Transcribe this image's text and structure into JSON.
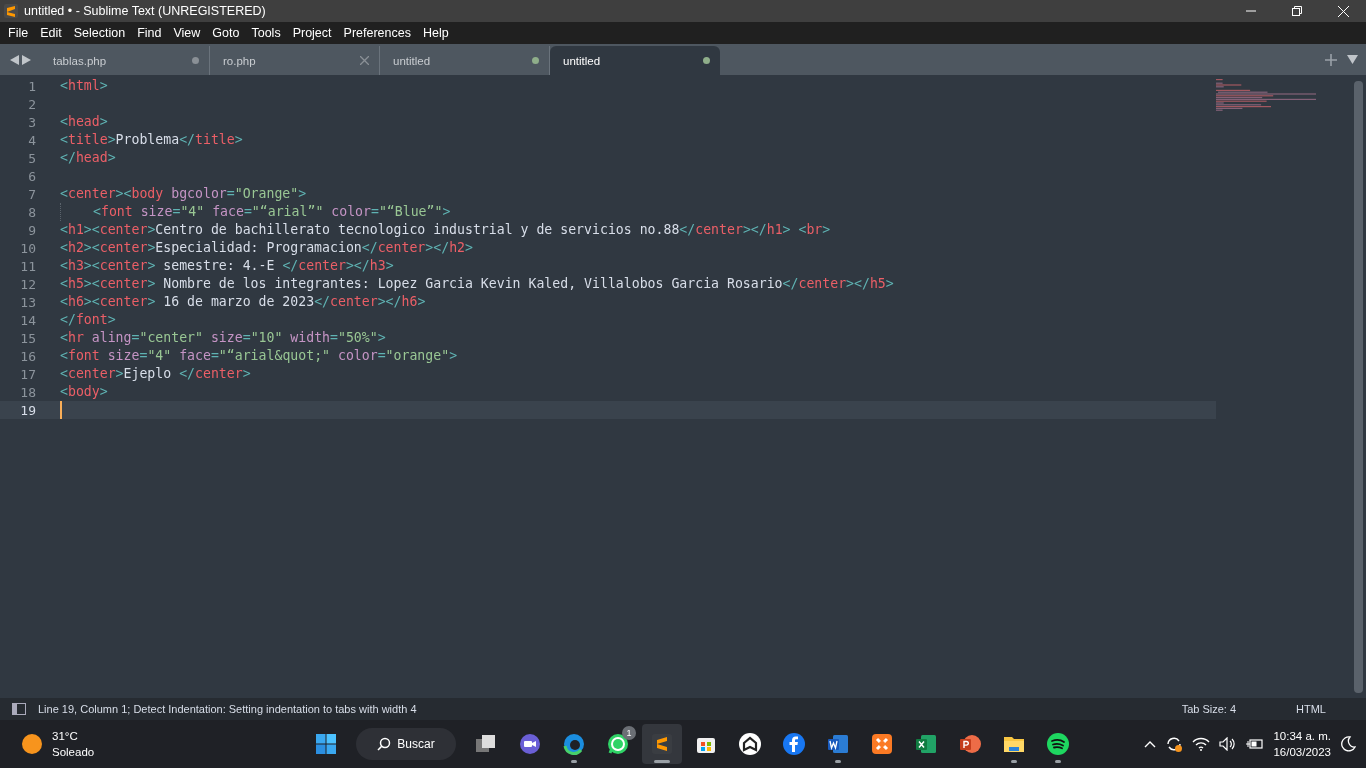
{
  "window": {
    "title": "untitled • - Sublime Text (UNREGISTERED)"
  },
  "menu": [
    "File",
    "Edit",
    "Selection",
    "Find",
    "View",
    "Goto",
    "Tools",
    "Project",
    "Preferences",
    "Help"
  ],
  "tabs": [
    {
      "label": "tablas.php",
      "selected": false,
      "modified": true,
      "color": "#8a9096"
    },
    {
      "label": "ro.php",
      "selected": false,
      "modified": false
    },
    {
      "label": "untitled",
      "selected": false,
      "modified": true,
      "color": "#8fae8a"
    },
    {
      "label": "untitled",
      "selected": true,
      "modified": true,
      "color": "#8fae8a"
    }
  ],
  "editor": {
    "lines": [
      {
        "number": "1",
        "current": false,
        "tokens": [
          {
            "kind": "punct",
            "text": "<"
          },
          {
            "kind": "tag",
            "text": "html"
          },
          {
            "kind": "punct",
            "text": ">"
          }
        ]
      },
      {
        "number": "2",
        "current": false
      },
      {
        "number": "3",
        "current": false,
        "tokens": [
          {
            "kind": "punct",
            "text": "<"
          },
          {
            "kind": "tag",
            "text": "head"
          },
          {
            "kind": "punct",
            "text": ">"
          }
        ]
      },
      {
        "number": "4",
        "current": false,
        "tokens": [
          {
            "kind": "punct",
            "text": "<"
          },
          {
            "kind": "tag",
            "text": "title"
          },
          {
            "kind": "punct",
            "text": ">"
          },
          {
            "kind": "text",
            "text": "Problema"
          },
          {
            "kind": "punct",
            "text": "</"
          },
          {
            "kind": "tag",
            "text": "title"
          },
          {
            "kind": "punct",
            "text": ">"
          }
        ]
      },
      {
        "number": "5",
        "current": false,
        "tokens": [
          {
            "kind": "punct",
            "text": "</"
          },
          {
            "kind": "tag",
            "text": "head"
          },
          {
            "kind": "punct",
            "text": ">"
          }
        ]
      },
      {
        "number": "6",
        "current": false
      },
      {
        "number": "7",
        "current": false,
        "tokens": [
          {
            "kind": "punct",
            "text": "<"
          },
          {
            "kind": "tag",
            "text": "center"
          },
          {
            "kind": "punct",
            "text": "><"
          },
          {
            "kind": "tag",
            "text": "body"
          },
          {
            "kind": "attr",
            "text": " bgcolor"
          },
          {
            "kind": "punct",
            "text": "="
          },
          {
            "kind": "string",
            "text": "\"Orange\""
          },
          {
            "kind": "punct",
            "text": ">"
          }
        ]
      },
      {
        "number": "8",
        "current": false,
        "indented": true,
        "tokens": [
          {
            "kind": "punct",
            "text": "<"
          },
          {
            "kind": "tag",
            "text": "font"
          },
          {
            "kind": "attr",
            "text": " size"
          },
          {
            "kind": "punct",
            "text": "="
          },
          {
            "kind": "string",
            "text": "\"4\""
          },
          {
            "kind": "attr",
            "text": " face"
          },
          {
            "kind": "punct",
            "text": "="
          },
          {
            "kind": "string",
            "text": "\"“arial”\""
          },
          {
            "kind": "attr",
            "text": " color"
          },
          {
            "kind": "punct",
            "text": "="
          },
          {
            "kind": "string",
            "text": "\"“Blue”\""
          },
          {
            "kind": "punct",
            "text": ">"
          }
        ]
      },
      {
        "number": "9",
        "current": false,
        "tokens": [
          {
            "kind": "punct",
            "text": "<"
          },
          {
            "kind": "tag",
            "text": "h1"
          },
          {
            "kind": "punct",
            "text": "><"
          },
          {
            "kind": "tag",
            "text": "center"
          },
          {
            "kind": "punct",
            "text": ">"
          },
          {
            "kind": "text",
            "text": "Centro de bachillerato tecnologico industrial y de servicios no.88"
          },
          {
            "kind": "punct",
            "text": "</"
          },
          {
            "kind": "tag",
            "text": "center"
          },
          {
            "kind": "punct",
            "text": "></"
          },
          {
            "kind": "tag",
            "text": "h1"
          },
          {
            "kind": "punct",
            "text": "> <"
          },
          {
            "kind": "tag",
            "text": "br"
          },
          {
            "kind": "punct",
            "text": ">"
          }
        ]
      },
      {
        "number": "10",
        "current": false,
        "tokens": [
          {
            "kind": "punct",
            "text": "<"
          },
          {
            "kind": "tag",
            "text": "h2"
          },
          {
            "kind": "punct",
            "text": "><"
          },
          {
            "kind": "tag",
            "text": "center"
          },
          {
            "kind": "punct",
            "text": ">"
          },
          {
            "kind": "text",
            "text": "Especialidad: Programacion"
          },
          {
            "kind": "punct",
            "text": "</"
          },
          {
            "kind": "tag",
            "text": "center"
          },
          {
            "kind": "punct",
            "text": "></"
          },
          {
            "kind": "tag",
            "text": "h2"
          },
          {
            "kind": "punct",
            "text": ">"
          }
        ]
      },
      {
        "number": "11",
        "current": false,
        "tokens": [
          {
            "kind": "punct",
            "text": "<"
          },
          {
            "kind": "tag",
            "text": "h3"
          },
          {
            "kind": "punct",
            "text": "><"
          },
          {
            "kind": "tag",
            "text": "center"
          },
          {
            "kind": "punct",
            "text": ">"
          },
          {
            "kind": "text",
            "text": " semestre: 4.-E "
          },
          {
            "kind": "punct",
            "text": "</"
          },
          {
            "kind": "tag",
            "text": "center"
          },
          {
            "kind": "punct",
            "text": "></"
          },
          {
            "kind": "tag",
            "text": "h3"
          },
          {
            "kind": "punct",
            "text": ">"
          }
        ]
      },
      {
        "number": "12",
        "current": false,
        "tokens": [
          {
            "kind": "punct",
            "text": "<"
          },
          {
            "kind": "tag",
            "text": "h5"
          },
          {
            "kind": "punct",
            "text": "><"
          },
          {
            "kind": "tag",
            "text": "center"
          },
          {
            "kind": "punct",
            "text": ">"
          },
          {
            "kind": "text",
            "text": " Nombre de los integrantes: Lopez Garcia Kevin Kaled, Villalobos Garcia Rosario"
          },
          {
            "kind": "punct",
            "text": "</"
          },
          {
            "kind": "tag",
            "text": "center"
          },
          {
            "kind": "punct",
            "text": "></"
          },
          {
            "kind": "tag",
            "text": "h5"
          },
          {
            "kind": "punct",
            "text": ">"
          }
        ]
      },
      {
        "number": "13",
        "current": false,
        "tokens": [
          {
            "kind": "punct",
            "text": "<"
          },
          {
            "kind": "tag",
            "text": "h6"
          },
          {
            "kind": "punct",
            "text": "><"
          },
          {
            "kind": "tag",
            "text": "center"
          },
          {
            "kind": "punct",
            "text": ">"
          },
          {
            "kind": "text",
            "text": " 16 de marzo de 2023"
          },
          {
            "kind": "punct",
            "text": "</"
          },
          {
            "kind": "tag",
            "text": "center"
          },
          {
            "kind": "punct",
            "text": "></"
          },
          {
            "kind": "tag",
            "text": "h6"
          },
          {
            "kind": "punct",
            "text": ">"
          }
        ]
      },
      {
        "number": "14",
        "current": false,
        "tokens": [
          {
            "kind": "punct",
            "text": "</"
          },
          {
            "kind": "tag",
            "text": "font"
          },
          {
            "kind": "punct",
            "text": ">"
          }
        ]
      },
      {
        "number": "15",
        "current": false,
        "tokens": [
          {
            "kind": "punct",
            "text": "<"
          },
          {
            "kind": "tag",
            "text": "hr"
          },
          {
            "kind": "attr",
            "text": " aling"
          },
          {
            "kind": "punct",
            "text": "="
          },
          {
            "kind": "string",
            "text": "\"center\""
          },
          {
            "kind": "attr",
            "text": " size"
          },
          {
            "kind": "punct",
            "text": "="
          },
          {
            "kind": "string",
            "text": "\"10\""
          },
          {
            "kind": "attr",
            "text": " width"
          },
          {
            "kind": "punct",
            "text": "="
          },
          {
            "kind": "string",
            "text": "\"50%\""
          },
          {
            "kind": "punct",
            "text": ">"
          }
        ]
      },
      {
        "number": "16",
        "current": false,
        "tokens": [
          {
            "kind": "punct",
            "text": "<"
          },
          {
            "kind": "tag",
            "text": "font"
          },
          {
            "kind": "attr",
            "text": " size"
          },
          {
            "kind": "punct",
            "text": "="
          },
          {
            "kind": "string",
            "text": "\"4\""
          },
          {
            "kind": "attr",
            "text": " face"
          },
          {
            "kind": "punct",
            "text": "="
          },
          {
            "kind": "string",
            "text": "\"“arial&quot;\""
          },
          {
            "kind": "attr",
            "text": " color"
          },
          {
            "kind": "punct",
            "text": "="
          },
          {
            "kind": "string",
            "text": "\"orange\""
          },
          {
            "kind": "punct",
            "text": ">"
          }
        ]
      },
      {
        "number": "17",
        "current": false,
        "tokens": [
          {
            "kind": "punct",
            "text": "<"
          },
          {
            "kind": "tag",
            "text": "center"
          },
          {
            "kind": "punct",
            "text": ">"
          },
          {
            "kind": "text",
            "text": "Ejeplo "
          },
          {
            "kind": "punct",
            "text": "</"
          },
          {
            "kind": "tag",
            "text": "center"
          },
          {
            "kind": "punct",
            "text": ">"
          }
        ]
      },
      {
        "number": "18",
        "current": false,
        "tokens": [
          {
            "kind": "punct",
            "text": "<"
          },
          {
            "kind": "tag",
            "text": "body"
          },
          {
            "kind": "punct",
            "text": ">"
          }
        ]
      },
      {
        "number": "19",
        "current": true
      }
    ]
  },
  "status_bar": {
    "message": "Line 19, Column 1; Detect Indentation: Setting indentation to tabs with width 4",
    "tab_size": "Tab Size: 4",
    "syntax": "HTML"
  },
  "taskbar": {
    "weather": {
      "temperature": "31°C",
      "condition": "Soleado"
    },
    "search": "Buscar",
    "apps": [
      {
        "kind": "windows",
        "running": false,
        "active": false
      },
      {
        "kind": "search"
      },
      {
        "kind": "task-view",
        "running": false,
        "active": false
      },
      {
        "kind": "meet",
        "running": false,
        "active": false
      },
      {
        "kind": "edge",
        "running": true,
        "active": false
      },
      {
        "kind": "whatsapp",
        "running": false,
        "active": false,
        "badge": "1"
      },
      {
        "kind": "sublime",
        "running": true,
        "active": true
      },
      {
        "kind": "store",
        "running": false,
        "active": false
      },
      {
        "kind": "house",
        "running": false,
        "active": false
      },
      {
        "kind": "facebook",
        "running": false,
        "active": false
      },
      {
        "kind": "word",
        "running": true,
        "active": false
      },
      {
        "kind": "xampp",
        "running": false,
        "active": false
      },
      {
        "kind": "excel",
        "running": false,
        "active": false
      },
      {
        "kind": "powerpoint",
        "running": false,
        "active": false
      },
      {
        "kind": "folder",
        "running": true,
        "active": false
      },
      {
        "kind": "spotify",
        "running": true,
        "active": false
      }
    ],
    "clock": {
      "time": "10:34 a. m.",
      "date": "16/03/2023"
    }
  }
}
